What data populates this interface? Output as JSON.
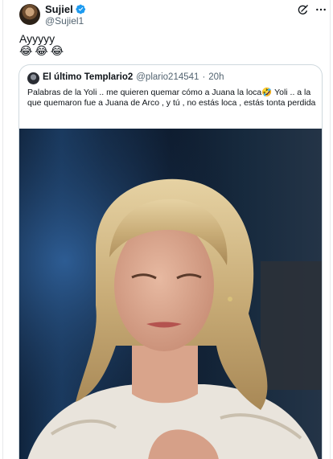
{
  "tweet": {
    "display_name": "Sujiel",
    "handle": "@Sujiel1",
    "text": "Ayyyyy",
    "emojis": [
      "😂",
      "😂",
      "😂"
    ],
    "icons": {
      "avatar": "profile-avatar",
      "verified": "verified-badge-icon",
      "grok": "grok-icon",
      "more": "more-options-icon"
    },
    "colors": {
      "verified": "#1d9bf0",
      "secondary_text": "#536471",
      "border": "#cfd9de"
    }
  },
  "quoted": {
    "display_name": "El último Templario2",
    "handle": "@plario214541",
    "separator": "·",
    "time": "20h",
    "body": "Palabras de la Yoli .. me quieren quemar cómo a Juana la loca🤣 Yoli .. a la que quemaron fue a Juana de Arco , y tú , no estás loca , estás tonta perdida",
    "media": "photo-woman-blonde-hair"
  }
}
